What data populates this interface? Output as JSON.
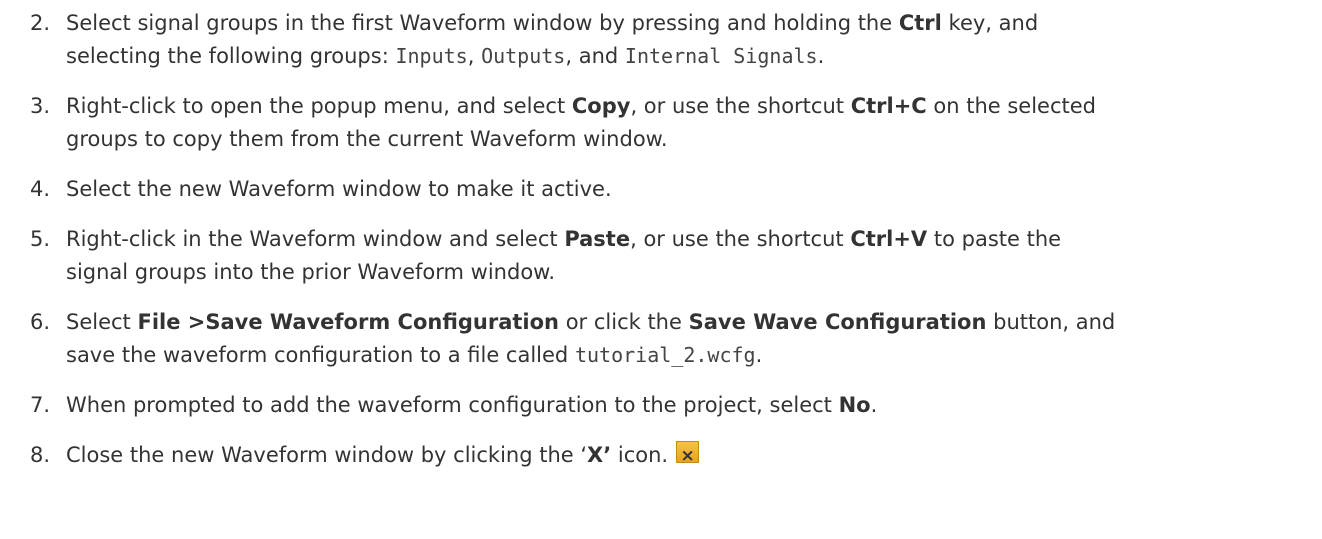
{
  "steps": [
    {
      "n": "2.",
      "lines": [
        [
          {
            "t": "Select signal groups in the first Waveform window by pressing and holding the "
          },
          {
            "t": "Ctrl",
            "b": true
          },
          {
            "t": " key, and"
          }
        ],
        [
          {
            "t": "selecting the following groups: "
          },
          {
            "t": "Inputs",
            "c": true
          },
          {
            "t": ", "
          },
          {
            "t": "Outputs",
            "c": true
          },
          {
            "t": ", and "
          },
          {
            "t": "Internal Signals",
            "c": true
          },
          {
            "t": "."
          }
        ]
      ]
    },
    {
      "n": "3.",
      "lines": [
        [
          {
            "t": "Right-click to open the popup menu, and select "
          },
          {
            "t": "Copy",
            "b": true
          },
          {
            "t": ", or use the shortcut "
          },
          {
            "t": "Ctrl+C",
            "b": true
          },
          {
            "t": " on the selected"
          }
        ],
        [
          {
            "t": "groups to copy them from the current Waveform window."
          }
        ]
      ]
    },
    {
      "n": "4.",
      "lines": [
        [
          {
            "t": "Select the new Waveform window to make it active."
          }
        ]
      ]
    },
    {
      "n": "5.",
      "lines": [
        [
          {
            "t": "Right-click in the Waveform window and select "
          },
          {
            "t": "Paste",
            "b": true
          },
          {
            "t": ", or use the shortcut "
          },
          {
            "t": "Ctrl+V",
            "b": true
          },
          {
            "t": " to paste the"
          }
        ],
        [
          {
            "t": "signal groups into the prior Waveform window."
          }
        ]
      ]
    },
    {
      "n": "6.",
      "lines": [
        [
          {
            "t": "Select "
          },
          {
            "t": "File >Save Waveform Configuration",
            "b": true
          },
          {
            "t": " or click the "
          },
          {
            "t": "Save Wave Configuration",
            "b": true
          },
          {
            "t": " button, and"
          }
        ],
        [
          {
            "t": "save the waveform configuration to a file called "
          },
          {
            "t": "tutorial_2.wcfg",
            "c": true
          },
          {
            "t": "."
          }
        ]
      ]
    },
    {
      "n": "7.",
      "lines": [
        [
          {
            "t": "When prompted to add the waveform configuration to the project, select "
          },
          {
            "t": "No",
            "b": true
          },
          {
            "t": "."
          }
        ]
      ]
    },
    {
      "n": "8.",
      "lines": [
        [
          {
            "t": "Close the new Waveform window by clicking the ‘"
          },
          {
            "t": "X’",
            "b": true
          },
          {
            "t": " icon."
          },
          {
            "icon": "close-x-icon",
            "glyph": "×"
          }
        ]
      ]
    }
  ]
}
